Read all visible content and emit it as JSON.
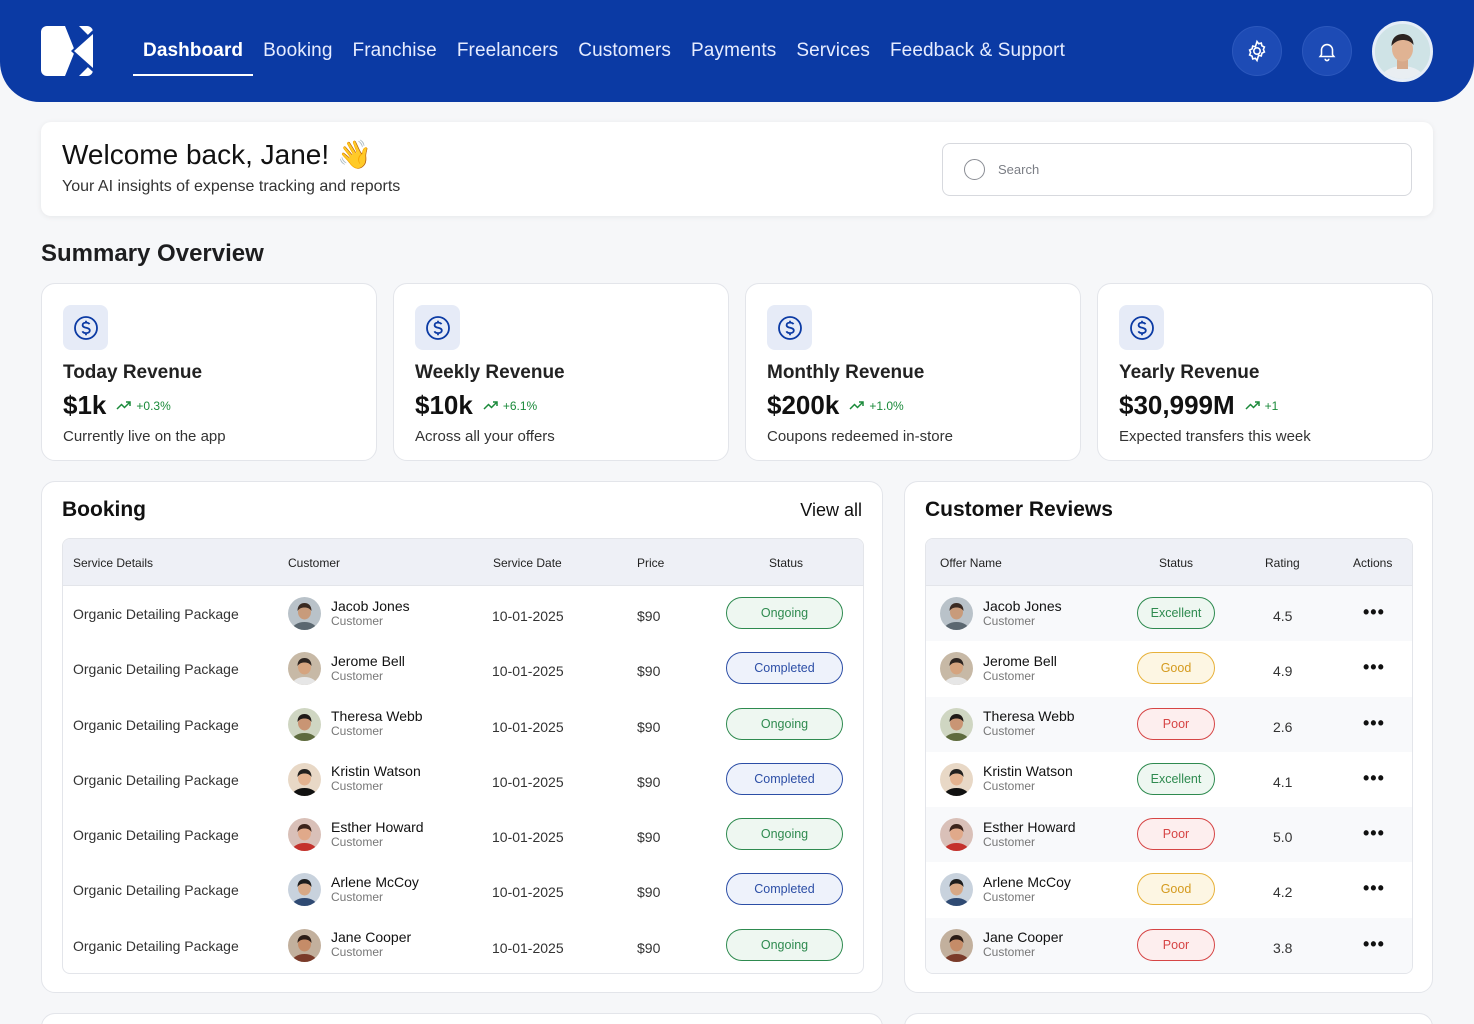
{
  "nav": {
    "items": [
      "Dashboard",
      "Booking",
      "Franchise",
      "Freelancers",
      "Customers",
      "Payments",
      "Services",
      "Feedback & Support"
    ],
    "active": "Dashboard"
  },
  "welcome": {
    "title": "Welcome back, Jane! 👋",
    "subtitle": "Your AI insights of expense tracking and reports",
    "search_placeholder": "Search"
  },
  "summary": {
    "title": "Summary Overview",
    "cards": [
      {
        "title": "Today Revenue",
        "value": "$1k",
        "trend": "+0.3%",
        "sub": "Currently live on the app"
      },
      {
        "title": "Weekly Revenue",
        "value": "$10k",
        "trend": "+6.1%",
        "sub": "Across all your offers"
      },
      {
        "title": "Monthly Revenue",
        "value": "$200k",
        "trend": "+1.0%",
        "sub": "Coupons redeemed in-store"
      },
      {
        "title": "Yearly Revenue",
        "value": "$30,999M",
        "trend": "+1",
        "sub": "Expected transfers this week"
      }
    ]
  },
  "booking": {
    "title": "Booking",
    "view_all": "View all",
    "columns": [
      "Service Details",
      "Customer",
      "Service Date",
      "Price",
      "Status"
    ],
    "rows": [
      {
        "service": "Organic Detailing Package",
        "name": "Jacob Jones",
        "role": "Customer",
        "date": "10-01-2025",
        "price": "$90",
        "status": "Ongoing"
      },
      {
        "service": "Organic Detailing Package",
        "name": "Jerome Bell",
        "role": "Customer",
        "date": "10-01-2025",
        "price": "$90",
        "status": "Completed"
      },
      {
        "service": "Organic Detailing Package",
        "name": "Theresa Webb",
        "role": "Customer",
        "date": "10-01-2025",
        "price": "$90",
        "status": "Ongoing"
      },
      {
        "service": "Organic Detailing Package",
        "name": "Kristin Watson",
        "role": "Customer",
        "date": "10-01-2025",
        "price": "$90",
        "status": "Completed"
      },
      {
        "service": "Organic Detailing Package",
        "name": "Esther Howard",
        "role": "Customer",
        "date": "10-01-2025",
        "price": "$90",
        "status": "Ongoing"
      },
      {
        "service": "Organic Detailing Package",
        "name": "Arlene McCoy",
        "role": "Customer",
        "date": "10-01-2025",
        "price": "$90",
        "status": "Completed"
      },
      {
        "service": "Organic Detailing Package",
        "name": "Jane Cooper",
        "role": "Customer",
        "date": "10-01-2025",
        "price": "$90",
        "status": "Ongoing"
      }
    ]
  },
  "reviews": {
    "title": "Customer Reviews",
    "columns": [
      "Offer Name",
      "Status",
      "Rating",
      "Actions"
    ],
    "rows": [
      {
        "name": "Jacob Jones",
        "role": "Customer",
        "status": "Excellent",
        "rating": "4.5"
      },
      {
        "name": "Jerome Bell",
        "role": "Customer",
        "status": "Good",
        "rating": "4.9"
      },
      {
        "name": "Theresa Webb",
        "role": "Customer",
        "status": "Poor",
        "rating": "2.6"
      },
      {
        "name": "Kristin Watson",
        "role": "Customer",
        "status": "Excellent",
        "rating": "4.1"
      },
      {
        "name": "Esther Howard",
        "role": "Customer",
        "status": "Poor",
        "rating": "5.0"
      },
      {
        "name": "Arlene McCoy",
        "role": "Customer",
        "status": "Good",
        "rating": "4.2"
      },
      {
        "name": "Jane Cooper",
        "role": "Customer",
        "status": "Poor",
        "rating": "3.8"
      }
    ]
  },
  "colors": {
    "brand": "#0b3aa4",
    "ongoing": "#2e8a4f",
    "completed": "#2c4ea6",
    "good": "#e7b13a",
    "poor": "#d64545",
    "trend": "#1a8a3a"
  },
  "icons": {
    "settings": "gear-icon",
    "notifications": "bell-icon",
    "revenue": "dollar-icon",
    "trend": "trend-up-icon",
    "search": "search-icon",
    "actions": "more-icon"
  }
}
